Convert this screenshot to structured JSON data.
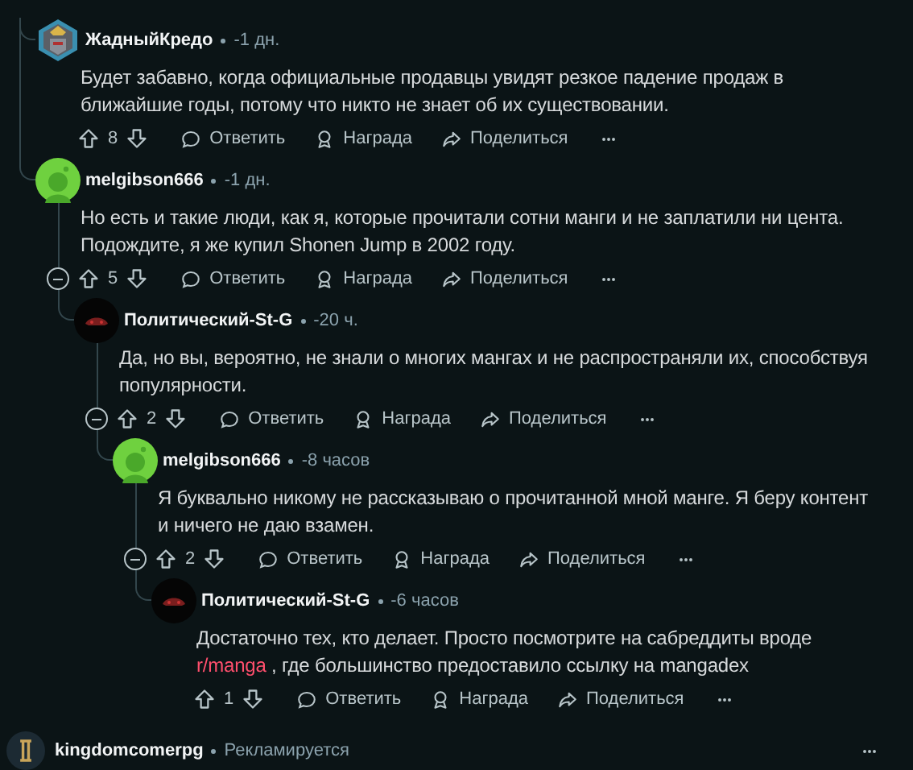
{
  "comments": [
    {
      "author": "ЖадныйКредо",
      "time": "-1 дн.",
      "avatar": {
        "kind": "custom"
      },
      "body": [
        {
          "text": "Будет забавно, когда официальные продавцы увидят резкое падение продаж в ближайшие годы, потому что никто не знает об их существовании."
        }
      ],
      "votes": "8",
      "actions": [
        "Ответить",
        "Награда",
        "Поделиться"
      ]
    },
    {
      "author": "melgibson666",
      "time": "-1 дн.",
      "avatar": {
        "kind": "snoo"
      },
      "body": [
        {
          "text": "Но есть и такие люди, как я, которые прочитали сотни манги и не заплатили ни цента. Подождите, я же купил Shonen Jump в 2002 году."
        }
      ],
      "votes": "5",
      "actions": [
        "Ответить",
        "Награда",
        "Поделиться"
      ],
      "children": [
        {
          "author": "Политический-St-G",
          "time": "-20 ч.",
          "avatar": {
            "kind": "dark"
          },
          "body": [
            {
              "text": "Да, но вы, вероятно, не знали о многих мангах и не распространяли их, способствуя популярности."
            }
          ],
          "votes": "2",
          "actions": [
            "Ответить",
            "Награда",
            "Поделиться"
          ],
          "children": [
            {
              "author": "melgibson666",
              "time": "-8 часов",
              "avatar": {
                "kind": "snoo"
              },
              "body": [
                {
                  "text": "Я буквально никому не рассказываю о прочитанной мной манге. Я беру контент и ничего не даю взамен."
                }
              ],
              "votes": "2",
              "actions": [
                "Ответить",
                "Награда",
                "Поделиться"
              ],
              "children": [
                {
                  "author": "Политический-St-G",
                  "time": "-6 часов",
                  "avatar": {
                    "kind": "dark"
                  },
                  "body": [
                    {
                      "text": "Достаточно тех, кто делает. Просто посмотрите на сабреддиты вроде "
                    },
                    {
                      "text": "r/manga",
                      "kind": "link"
                    },
                    {
                      "text": " , где большинство предоставило ссылку на mangadex"
                    }
                  ],
                  "votes": "1",
                  "actions": [
                    "Ответить",
                    "Награда",
                    "Поделиться"
                  ]
                }
              ]
            }
          ]
        }
      ]
    }
  ],
  "ad": {
    "author": "kingdomcomerpg",
    "label": "Рекламируется"
  }
}
